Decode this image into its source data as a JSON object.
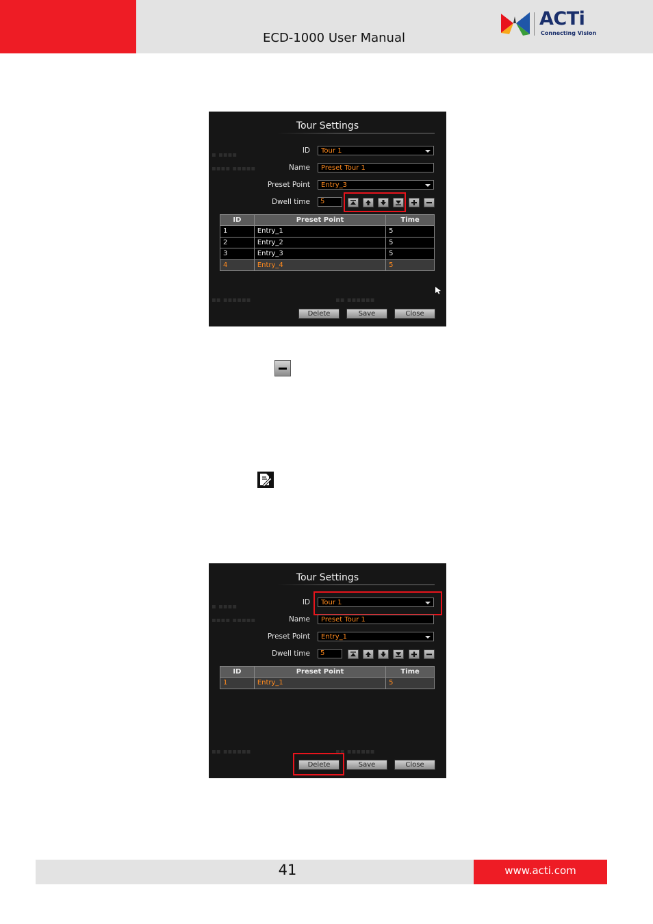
{
  "header": {
    "title": "ECD-1000 User Manual",
    "logo_word": "ACTi",
    "logo_tagline": "Connecting Vision"
  },
  "panel_a": {
    "title": "Tour Settings",
    "labels": {
      "id": "ID",
      "name": "Name",
      "preset_point": "Preset Point",
      "dwell_time": "Dwell time"
    },
    "id_value": "Tour 1",
    "name_value": "Preset Tour 1",
    "preset_value": "Entry_3",
    "dwell_value": "5",
    "table": {
      "headers": [
        "ID",
        "Preset Point",
        "Time"
      ],
      "rows": [
        [
          "1",
          "Entry_1",
          "5"
        ],
        [
          "2",
          "Entry_2",
          "5"
        ],
        [
          "3",
          "Entry_3",
          "5"
        ],
        [
          "4",
          "Entry_4",
          "5"
        ]
      ]
    },
    "buttons": {
      "delete": "Delete",
      "save": "Save",
      "close": "Close"
    }
  },
  "panel_b": {
    "title": "Tour Settings",
    "labels": {
      "id": "ID",
      "name": "Name",
      "preset_point": "Preset Point",
      "dwell_time": "Dwell time"
    },
    "id_value": "Tour 1",
    "name_value": "Preset Tour 1",
    "preset_value": "Entry_1",
    "dwell_value": "5",
    "table": {
      "headers": [
        "ID",
        "Preset Point",
        "Time"
      ],
      "rows": [
        [
          "1",
          "Entry_1",
          "5"
        ]
      ]
    },
    "buttons": {
      "delete": "Delete",
      "save": "Save",
      "close": "Close"
    }
  },
  "icons": [
    "minus-icon",
    "edit-icon",
    "move-top-icon",
    "move-up-icon",
    "move-down-icon",
    "move-bottom-icon",
    "plus-icon",
    "cursor-icon"
  ],
  "colors": {
    "brand_red": "#ee1c25",
    "accent_orange": "#ff8a1e",
    "highlight_red": "#e8141c"
  },
  "footer": {
    "page_number": "41",
    "url": "www.acti.com"
  }
}
